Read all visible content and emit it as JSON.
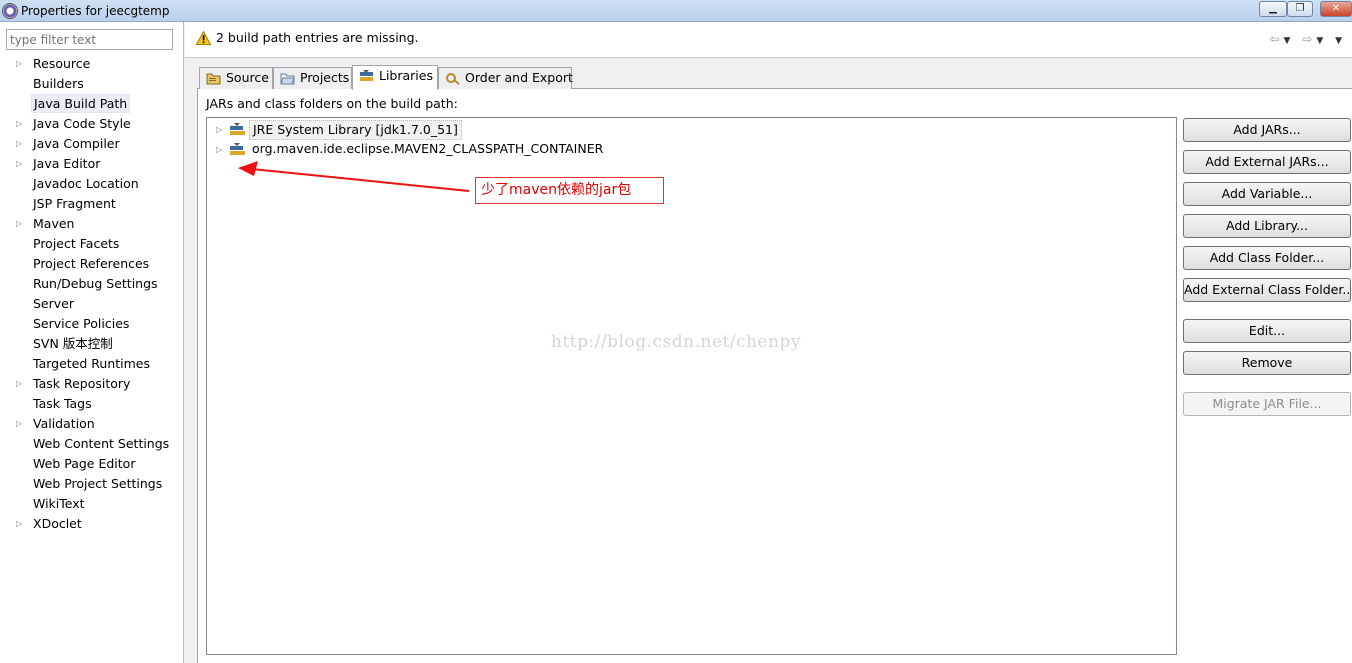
{
  "window": {
    "title": "Properties for jeecgtemp",
    "controls": [
      "minimize",
      "maximize",
      "close"
    ]
  },
  "filter": {
    "placeholder": "type filter text"
  },
  "nav": {
    "items": [
      {
        "label": "Resource",
        "expandable": true
      },
      {
        "label": "Builders",
        "expandable": false
      },
      {
        "label": "Java Build Path",
        "expandable": false,
        "selected": true
      },
      {
        "label": "Java Code Style",
        "expandable": true
      },
      {
        "label": "Java Compiler",
        "expandable": true
      },
      {
        "label": "Java Editor",
        "expandable": true
      },
      {
        "label": "Javadoc Location",
        "expandable": false
      },
      {
        "label": "JSP Fragment",
        "expandable": false
      },
      {
        "label": "Maven",
        "expandable": true
      },
      {
        "label": "Project Facets",
        "expandable": false
      },
      {
        "label": "Project References",
        "expandable": false
      },
      {
        "label": "Run/Debug Settings",
        "expandable": false
      },
      {
        "label": "Server",
        "expandable": false
      },
      {
        "label": "Service Policies",
        "expandable": false
      },
      {
        "label": "SVN 版本控制",
        "expandable": false
      },
      {
        "label": "Targeted Runtimes",
        "expandable": false
      },
      {
        "label": "Task Repository",
        "expandable": true
      },
      {
        "label": "Task Tags",
        "expandable": false
      },
      {
        "label": "Validation",
        "expandable": true
      },
      {
        "label": "Web Content Settings",
        "expandable": false
      },
      {
        "label": "Web Page Editor",
        "expandable": false
      },
      {
        "label": "Web Project Settings",
        "expandable": false
      },
      {
        "label": "WikiText",
        "expandable": false
      },
      {
        "label": "XDoclet",
        "expandable": true
      }
    ]
  },
  "message": {
    "text": "2 build path entries are missing.",
    "icon": "warning-icon"
  },
  "tabs": [
    {
      "label": "Source",
      "icon": "source-folder-icon"
    },
    {
      "label": "Projects",
      "icon": "projects-folder-icon"
    },
    {
      "label": "Libraries",
      "icon": "libraries-icon",
      "active": true
    },
    {
      "label": "Order and Export",
      "icon": "order-export-icon"
    }
  ],
  "libraries": {
    "caption": "JARs and class folders on the build path:",
    "entries": [
      {
        "label": "JRE System Library [jdk1.7.0_51]"
      },
      {
        "label": "org.maven.ide.eclipse.MAVEN2_CLASSPATH_CONTAINER"
      }
    ]
  },
  "annotation": {
    "text": "少了maven依赖的jar包",
    "color": "#e00000"
  },
  "watermark": "http://blog.csdn.net/chenpy",
  "buttons": [
    {
      "label": "Add JARs...",
      "enabled": true
    },
    {
      "label": "Add External JARs...",
      "enabled": true
    },
    {
      "label": "Add Variable...",
      "enabled": true
    },
    {
      "label": "Add Library...",
      "enabled": true
    },
    {
      "label": "Add Class Folder...",
      "enabled": true
    },
    {
      "label": "Add External Class Folder...",
      "enabled": true
    },
    {
      "label": "Edit...",
      "enabled": true
    },
    {
      "label": "Remove",
      "enabled": true
    },
    {
      "label": "Migrate JAR File...",
      "enabled": false
    }
  ]
}
